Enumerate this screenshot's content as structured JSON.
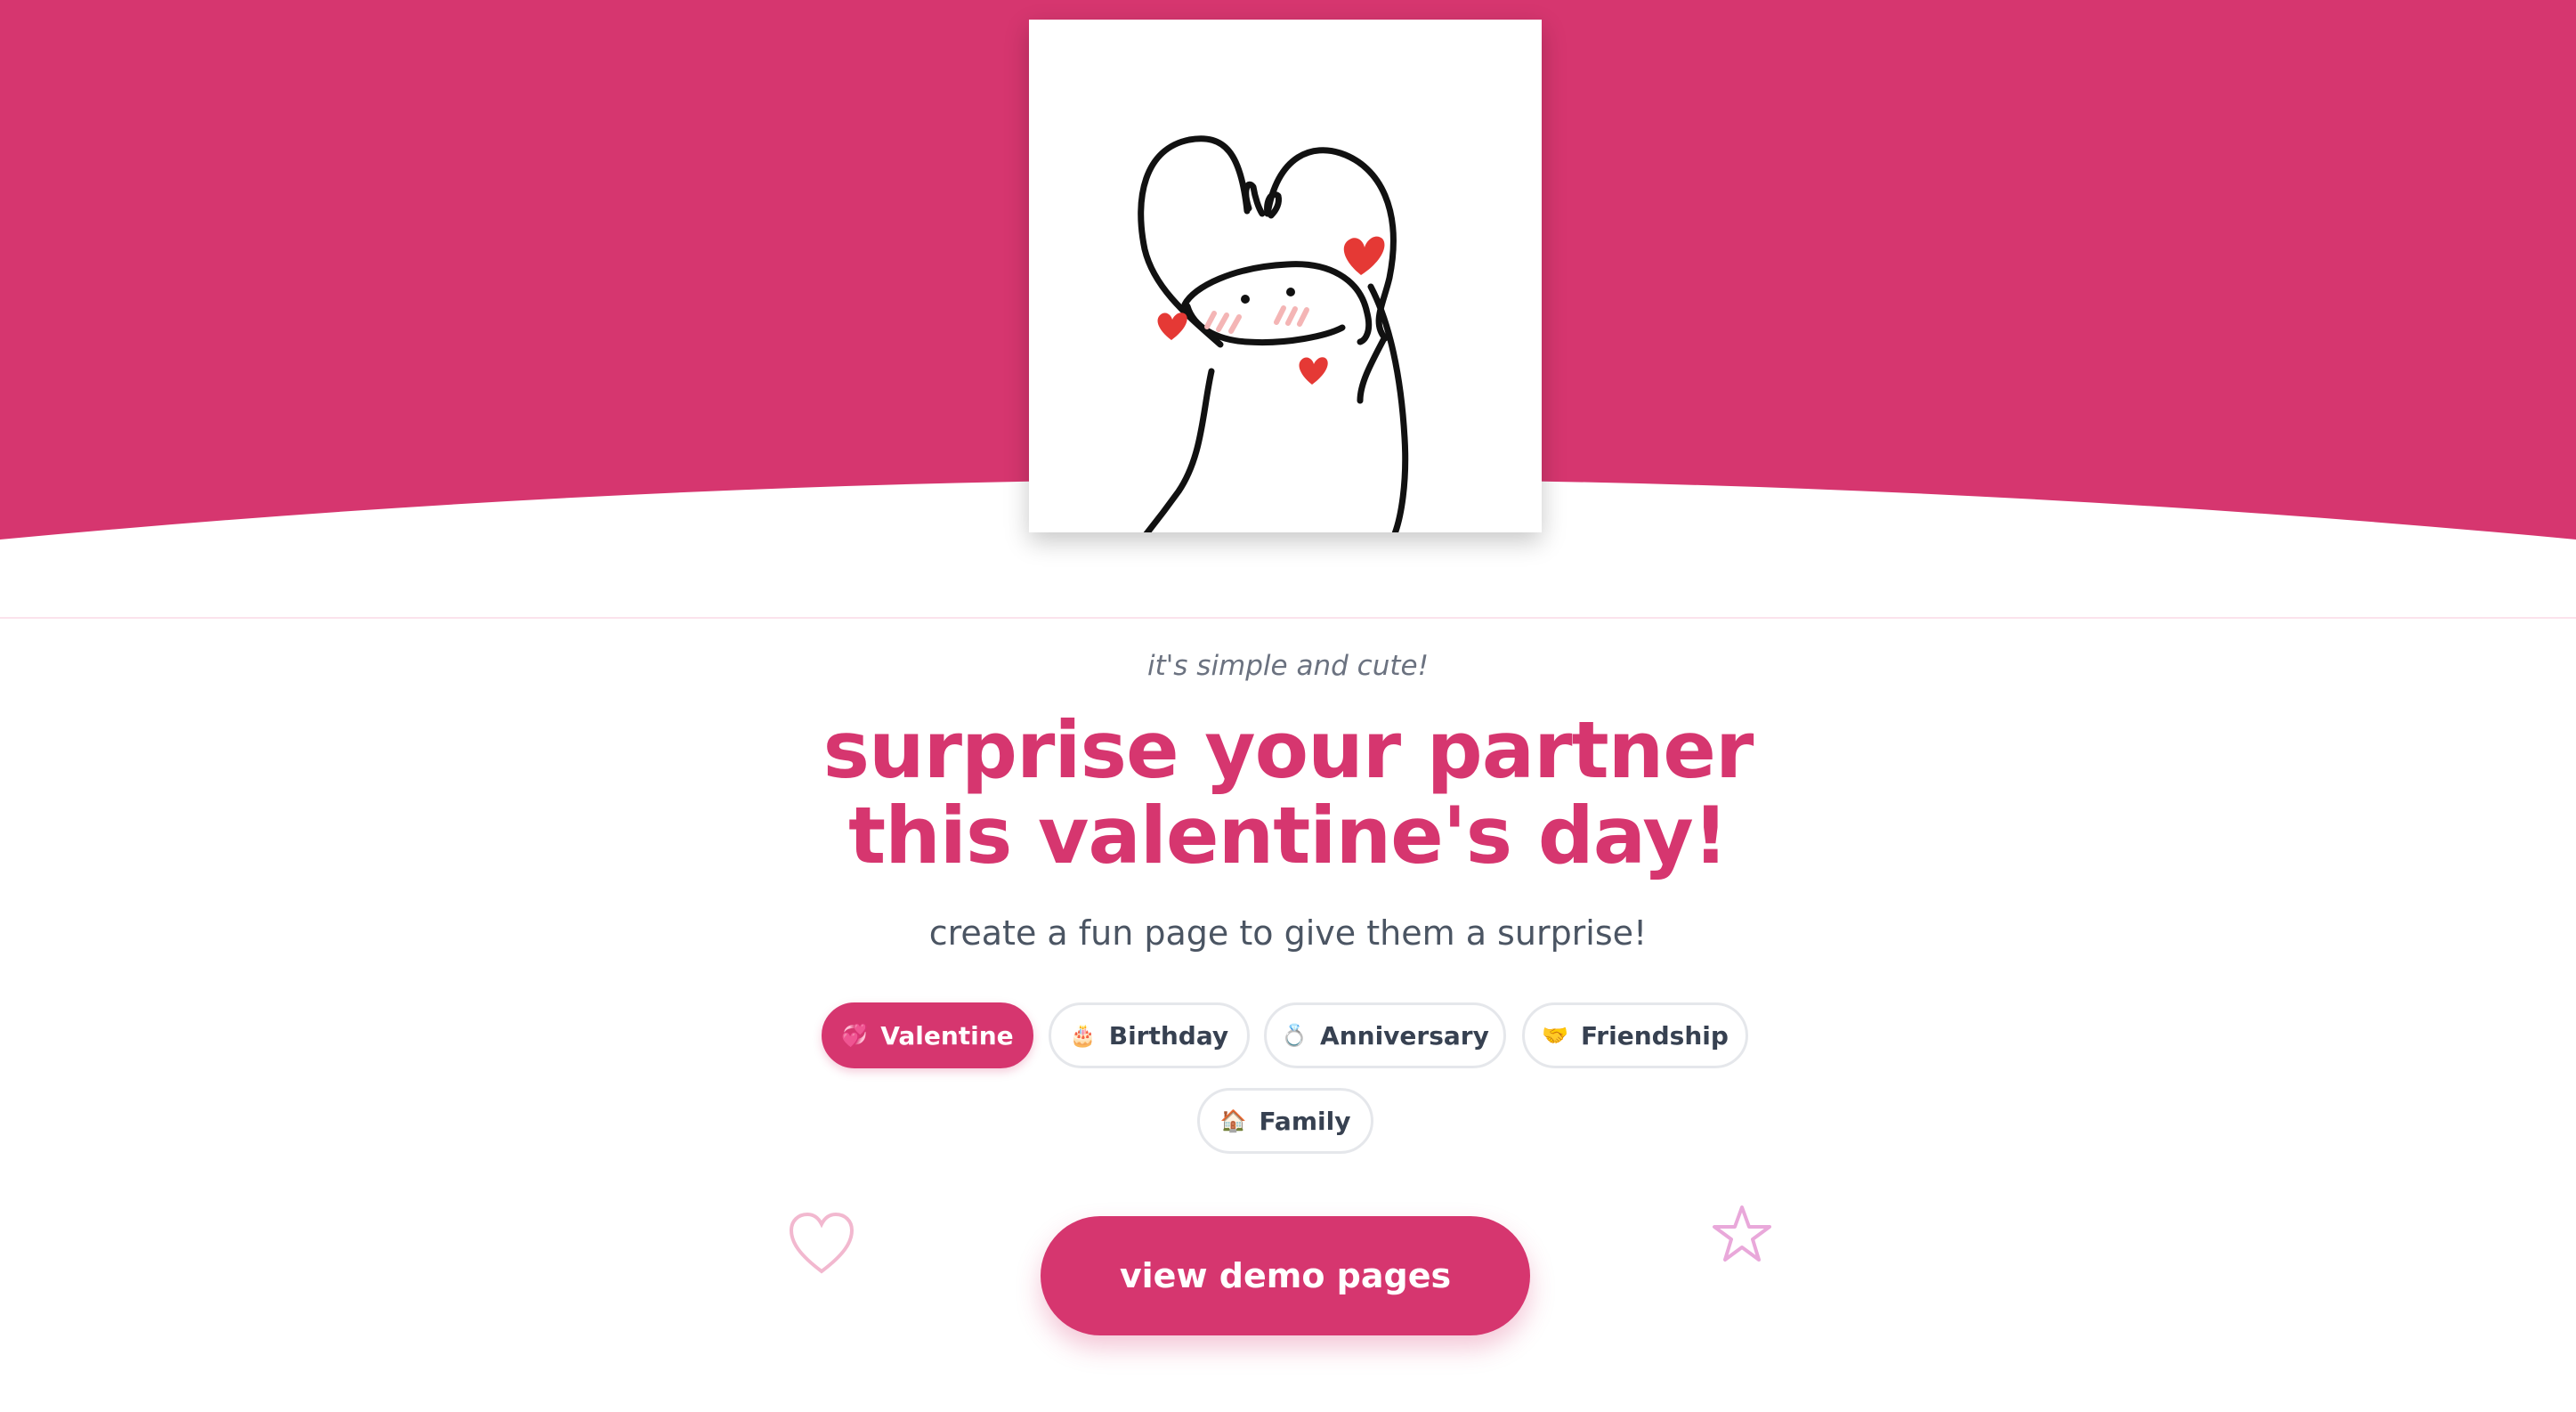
{
  "hero": {
    "brand_color": "#d6366f",
    "illustration": "heart-hands-character"
  },
  "tagline": "it's simple and cute!",
  "headline": {
    "line1": "surprise your partner",
    "line2": "this valentine's day!"
  },
  "subtitle": "create a fun page to give them a surprise!",
  "categories": [
    {
      "emoji": "💞",
      "label": "Valentine",
      "active": true
    },
    {
      "emoji": "🎂",
      "label": "Birthday",
      "active": false
    },
    {
      "emoji": "💍",
      "label": "Anniversary",
      "active": false
    },
    {
      "emoji": "🤝",
      "label": "Friendship",
      "active": false
    },
    {
      "emoji": "🏠",
      "label": "Family",
      "active": false
    }
  ],
  "cta_label": "view demo pages",
  "decorations": [
    "heart-outline-icon",
    "star-outline-icon"
  ]
}
